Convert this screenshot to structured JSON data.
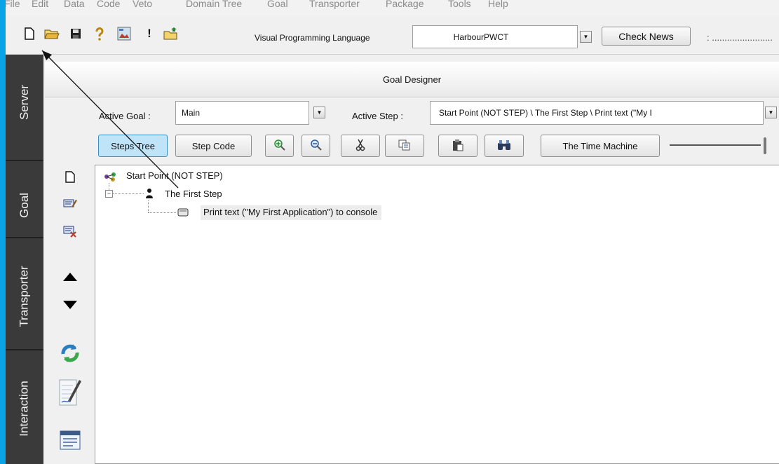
{
  "menu": [
    "File",
    "Edit",
    "Data",
    "Code",
    "Veto",
    "Domain Tree",
    "Goal",
    "Transporter",
    "Package",
    "Tools",
    "Help"
  ],
  "toolbar": {
    "icons": [
      "new-file-icon",
      "open-folder-icon",
      "save-disk-icon",
      "help-question-icon",
      "image-editor-icon",
      "exclamation-icon",
      "folder-upload-icon"
    ],
    "exclamation": "!",
    "vpl_label": "Visual Programming Language",
    "vpl_value": "HarbourPWCT",
    "check_news": "Check News",
    "trailing_text": ":  ........................"
  },
  "left_tabs": [
    "Server",
    "Goal",
    "Transporter",
    "Interaction"
  ],
  "designer": {
    "title": "Goal Designer",
    "active_goal_label": "Active Goal :",
    "active_goal_value": "Main",
    "active_step_label": "Active Step :",
    "active_step_value": "Start Point (NOT STEP) \\ The First Step \\ Print text (\"My I"
  },
  "buttons": {
    "steps_tree": "Steps Tree",
    "step_code": "Step Code",
    "time_machine": "The Time Machine"
  },
  "tree": {
    "root": "Start Point (NOT STEP)",
    "child": "The First Step",
    "leaf": "Print text (\"My First Application\") to console"
  },
  "colors": {
    "accent_blue": "#0aa3e8",
    "selected_button": "#bfe3f7",
    "side_panel": "#3a3a3a"
  }
}
